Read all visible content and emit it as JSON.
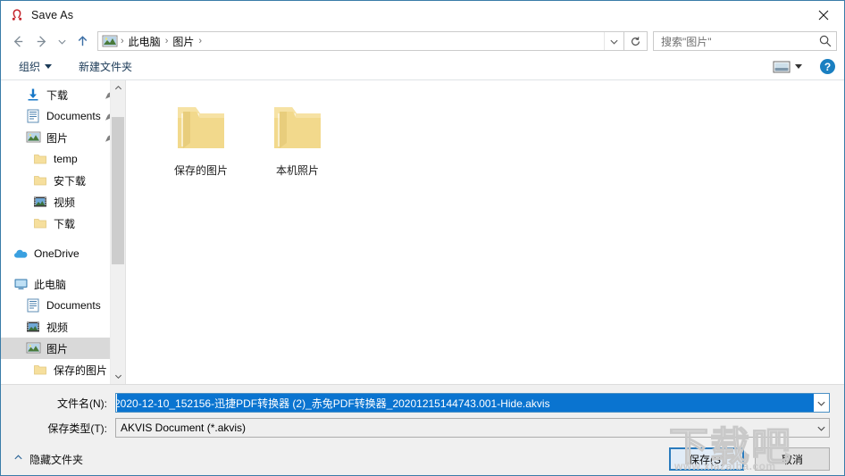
{
  "window": {
    "title": "Save As",
    "app_icon": "akvis-horseshoe-icon",
    "close_label": "✕"
  },
  "nav": {
    "back_icon": "arrow-left-icon",
    "forward_icon": "arrow-right-icon",
    "recent_icon": "chevron-down-icon",
    "up_icon": "arrow-up-icon",
    "address_icon": "pictures-folder-icon",
    "breadcrumbs": [
      "此电脑",
      "图片"
    ],
    "separator": "›",
    "dropdown_icon": "chevron-down-icon",
    "refresh_icon": "refresh-icon"
  },
  "search": {
    "placeholder": "搜索\"图片\"",
    "icon": "search-icon"
  },
  "toolbar": {
    "organize_label": "组织",
    "new_folder_label": "新建文件夹",
    "view_icon": "view-layout-icon",
    "view_dropdown_icon": "chevron-down-icon",
    "help_label": "?",
    "help_icon": "help-circle-icon"
  },
  "sidebar": {
    "quick_access": [
      {
        "label": "下载",
        "icon": "download-arrow-icon",
        "pinned": true,
        "indent": 1
      },
      {
        "label": "Documents",
        "icon": "document-icon",
        "pinned": true,
        "indent": 1
      },
      {
        "label": "图片",
        "icon": "pictures-icon",
        "pinned": true,
        "indent": 1
      },
      {
        "label": "temp",
        "icon": "folder-icon",
        "pinned": false,
        "indent": 2
      },
      {
        "label": "安下载",
        "icon": "folder-icon",
        "pinned": false,
        "indent": 2
      },
      {
        "label": "视频",
        "icon": "video-icon",
        "pinned": false,
        "indent": 2
      },
      {
        "label": "下载",
        "icon": "folder-icon",
        "pinned": false,
        "indent": 2
      }
    ],
    "onedrive": {
      "label": "OneDrive",
      "icon": "cloud-icon"
    },
    "this_pc": {
      "label": "此电脑",
      "icon": "computer-icon"
    },
    "this_pc_children": [
      {
        "label": "Documents",
        "icon": "document-icon",
        "selected": false
      },
      {
        "label": "视频",
        "icon": "video-icon",
        "selected": false
      },
      {
        "label": "图片",
        "icon": "pictures-icon",
        "selected": true
      },
      {
        "label": "保存的图片",
        "icon": "folder-icon",
        "selected": false
      }
    ],
    "scrollbar": {
      "up_icon": "chevron-up-icon",
      "down_icon": "chevron-down-icon"
    }
  },
  "content": {
    "folders": [
      {
        "name": "保存的图片",
        "icon": "folder-icon"
      },
      {
        "name": "本机照片",
        "icon": "folder-icon"
      }
    ]
  },
  "form": {
    "filename_label": "文件名(N):",
    "filename_value": "2020-12-10_152156-迅捷PDF转换器 (2)_赤兔PDF转换器_20201215144743.001-Hide.akvis",
    "filetype_label": "保存类型(T):",
    "filetype_value": "AKVIS Document (*.akvis)",
    "dropdown_icon": "chevron-down-icon"
  },
  "footer": {
    "hide_folders_label": "隐藏文件夹",
    "hide_folders_icon": "chevron-up-icon",
    "save_label": "保存(S)",
    "cancel_label": "取消"
  },
  "watermark": {
    "text": "下载吧",
    "url": "www.xiazaiba.com"
  },
  "colors": {
    "accent": "#2a7bbd",
    "selection": "#0a74d0",
    "folder": "#f3d88b",
    "dialog_border": "#3a7ca8",
    "form_bg": "#f0f0f0"
  }
}
